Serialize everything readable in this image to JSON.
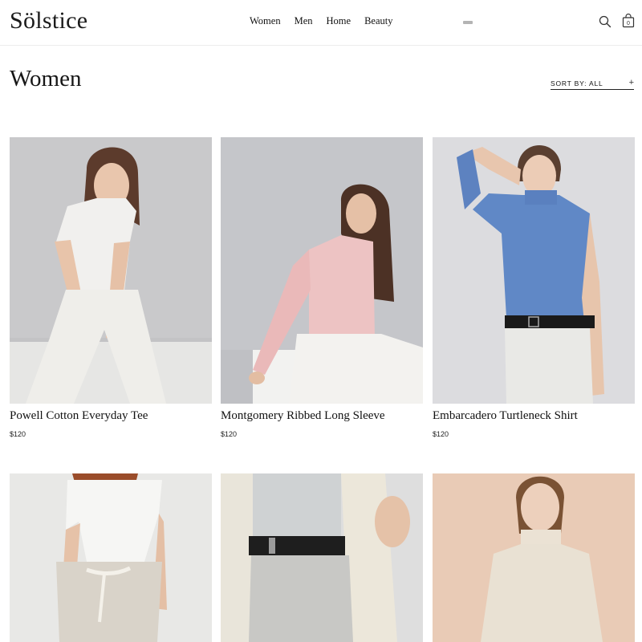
{
  "brand": {
    "logo": "Sölstice"
  },
  "nav": {
    "items": [
      {
        "label": "Women",
        "active": true
      },
      {
        "label": "Men",
        "active": false
      },
      {
        "label": "Home",
        "active": false
      },
      {
        "label": "Beauty",
        "active": false
      }
    ]
  },
  "header_icons": {
    "search": "search-icon",
    "bag": "shopping-bag-icon",
    "bag_count": "0",
    "menu": "menu-dash-icon"
  },
  "page": {
    "title": "Women"
  },
  "sort": {
    "label": "SORT BY: ALL",
    "toggle": "+"
  },
  "products": [
    {
      "name": "Powell Cotton Everyday Tee",
      "price": "$120"
    },
    {
      "name": "Montgomery Ribbed Long Sleeve",
      "price": "$120"
    },
    {
      "name": "Embarcadero Turtleneck Shirt",
      "price": "$120"
    },
    {
      "name": "",
      "price": ""
    },
    {
      "name": "",
      "price": ""
    },
    {
      "name": "",
      "price": ""
    }
  ],
  "colors": {
    "nav_highlight": "#c4dbc6",
    "divider": "#ececec"
  }
}
